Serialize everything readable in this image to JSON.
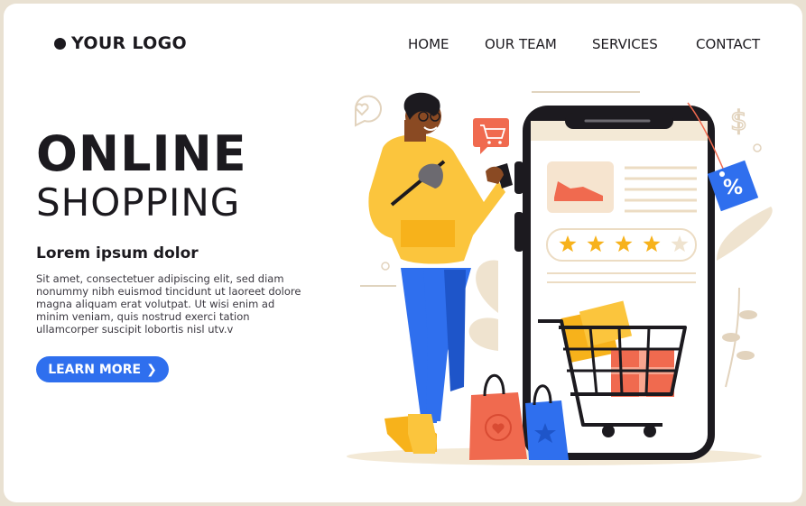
{
  "header": {
    "logo_text": "YOUR LOGO",
    "nav": [
      {
        "label": "HOME"
      },
      {
        "label": "OUR TEAM"
      },
      {
        "label": "SERVICES"
      },
      {
        "label": "CONTACT"
      }
    ]
  },
  "hero": {
    "title_line1": "ONLINE",
    "title_line2": "SHOPPING",
    "subheading": "Lorem ipsum dolor",
    "body": "Sit amet, consectetuer adipiscing elit, sed diam nonummy nibh euismod tincidunt ut laoreet dolore magna aliquam erat volutpat. Ut wisi enim ad minim veniam, quis nostrud exerci tation ullamcorper suscipit lobortis nisl utv.v",
    "cta_label": "LEARN MORE",
    "cta_icon": "chevron-right-icon"
  },
  "illustration": {
    "discount_tag": "%",
    "rating": {
      "value": 4,
      "max": 5
    },
    "icons": [
      "heart-bubble-icon",
      "cart-bubble-icon",
      "dollar-icon",
      "percent-tag-icon",
      "sneaker-icon",
      "shopping-cart-icon",
      "shopping-bag-icon"
    ]
  },
  "colors": {
    "accent_blue": "#2f6fee",
    "dark": "#1c1a1f",
    "yellow": "#f7b21b",
    "coral": "#f06a4f",
    "beige": "#efe3cf"
  }
}
